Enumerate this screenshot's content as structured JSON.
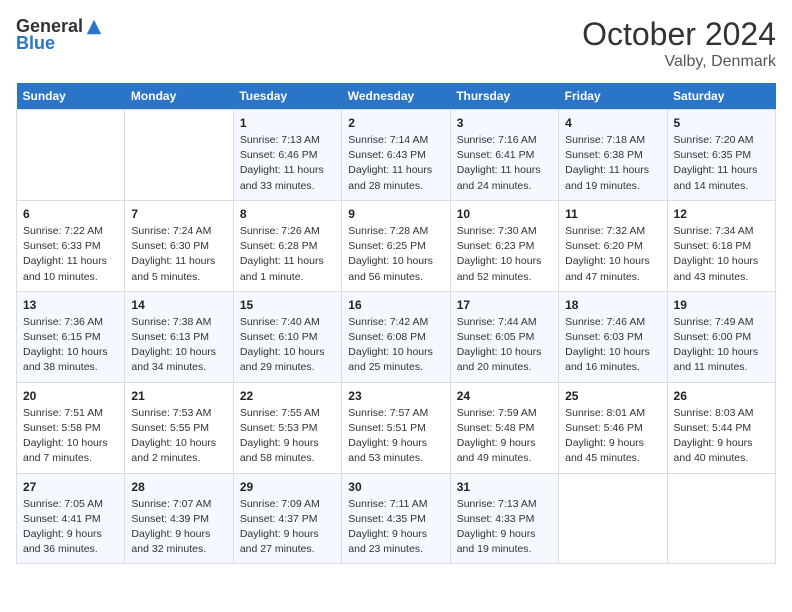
{
  "header": {
    "logo_general": "General",
    "logo_blue": "Blue",
    "month_title": "October 2024",
    "location": "Valby, Denmark"
  },
  "weekdays": [
    "Sunday",
    "Monday",
    "Tuesday",
    "Wednesday",
    "Thursday",
    "Friday",
    "Saturday"
  ],
  "weeks": [
    [
      {
        "day": "",
        "sunrise": "",
        "sunset": "",
        "daylight": ""
      },
      {
        "day": "",
        "sunrise": "",
        "sunset": "",
        "daylight": ""
      },
      {
        "day": "1",
        "sunrise": "Sunrise: 7:13 AM",
        "sunset": "Sunset: 6:46 PM",
        "daylight": "Daylight: 11 hours and 33 minutes."
      },
      {
        "day": "2",
        "sunrise": "Sunrise: 7:14 AM",
        "sunset": "Sunset: 6:43 PM",
        "daylight": "Daylight: 11 hours and 28 minutes."
      },
      {
        "day": "3",
        "sunrise": "Sunrise: 7:16 AM",
        "sunset": "Sunset: 6:41 PM",
        "daylight": "Daylight: 11 hours and 24 minutes."
      },
      {
        "day": "4",
        "sunrise": "Sunrise: 7:18 AM",
        "sunset": "Sunset: 6:38 PM",
        "daylight": "Daylight: 11 hours and 19 minutes."
      },
      {
        "day": "5",
        "sunrise": "Sunrise: 7:20 AM",
        "sunset": "Sunset: 6:35 PM",
        "daylight": "Daylight: 11 hours and 14 minutes."
      }
    ],
    [
      {
        "day": "6",
        "sunrise": "Sunrise: 7:22 AM",
        "sunset": "Sunset: 6:33 PM",
        "daylight": "Daylight: 11 hours and 10 minutes."
      },
      {
        "day": "7",
        "sunrise": "Sunrise: 7:24 AM",
        "sunset": "Sunset: 6:30 PM",
        "daylight": "Daylight: 11 hours and 5 minutes."
      },
      {
        "day": "8",
        "sunrise": "Sunrise: 7:26 AM",
        "sunset": "Sunset: 6:28 PM",
        "daylight": "Daylight: 11 hours and 1 minute."
      },
      {
        "day": "9",
        "sunrise": "Sunrise: 7:28 AM",
        "sunset": "Sunset: 6:25 PM",
        "daylight": "Daylight: 10 hours and 56 minutes."
      },
      {
        "day": "10",
        "sunrise": "Sunrise: 7:30 AM",
        "sunset": "Sunset: 6:23 PM",
        "daylight": "Daylight: 10 hours and 52 minutes."
      },
      {
        "day": "11",
        "sunrise": "Sunrise: 7:32 AM",
        "sunset": "Sunset: 6:20 PM",
        "daylight": "Daylight: 10 hours and 47 minutes."
      },
      {
        "day": "12",
        "sunrise": "Sunrise: 7:34 AM",
        "sunset": "Sunset: 6:18 PM",
        "daylight": "Daylight: 10 hours and 43 minutes."
      }
    ],
    [
      {
        "day": "13",
        "sunrise": "Sunrise: 7:36 AM",
        "sunset": "Sunset: 6:15 PM",
        "daylight": "Daylight: 10 hours and 38 minutes."
      },
      {
        "day": "14",
        "sunrise": "Sunrise: 7:38 AM",
        "sunset": "Sunset: 6:13 PM",
        "daylight": "Daylight: 10 hours and 34 minutes."
      },
      {
        "day": "15",
        "sunrise": "Sunrise: 7:40 AM",
        "sunset": "Sunset: 6:10 PM",
        "daylight": "Daylight: 10 hours and 29 minutes."
      },
      {
        "day": "16",
        "sunrise": "Sunrise: 7:42 AM",
        "sunset": "Sunset: 6:08 PM",
        "daylight": "Daylight: 10 hours and 25 minutes."
      },
      {
        "day": "17",
        "sunrise": "Sunrise: 7:44 AM",
        "sunset": "Sunset: 6:05 PM",
        "daylight": "Daylight: 10 hours and 20 minutes."
      },
      {
        "day": "18",
        "sunrise": "Sunrise: 7:46 AM",
        "sunset": "Sunset: 6:03 PM",
        "daylight": "Daylight: 10 hours and 16 minutes."
      },
      {
        "day": "19",
        "sunrise": "Sunrise: 7:49 AM",
        "sunset": "Sunset: 6:00 PM",
        "daylight": "Daylight: 10 hours and 11 minutes."
      }
    ],
    [
      {
        "day": "20",
        "sunrise": "Sunrise: 7:51 AM",
        "sunset": "Sunset: 5:58 PM",
        "daylight": "Daylight: 10 hours and 7 minutes."
      },
      {
        "day": "21",
        "sunrise": "Sunrise: 7:53 AM",
        "sunset": "Sunset: 5:55 PM",
        "daylight": "Daylight: 10 hours and 2 minutes."
      },
      {
        "day": "22",
        "sunrise": "Sunrise: 7:55 AM",
        "sunset": "Sunset: 5:53 PM",
        "daylight": "Daylight: 9 hours and 58 minutes."
      },
      {
        "day": "23",
        "sunrise": "Sunrise: 7:57 AM",
        "sunset": "Sunset: 5:51 PM",
        "daylight": "Daylight: 9 hours and 53 minutes."
      },
      {
        "day": "24",
        "sunrise": "Sunrise: 7:59 AM",
        "sunset": "Sunset: 5:48 PM",
        "daylight": "Daylight: 9 hours and 49 minutes."
      },
      {
        "day": "25",
        "sunrise": "Sunrise: 8:01 AM",
        "sunset": "Sunset: 5:46 PM",
        "daylight": "Daylight: 9 hours and 45 minutes."
      },
      {
        "day": "26",
        "sunrise": "Sunrise: 8:03 AM",
        "sunset": "Sunset: 5:44 PM",
        "daylight": "Daylight: 9 hours and 40 minutes."
      }
    ],
    [
      {
        "day": "27",
        "sunrise": "Sunrise: 7:05 AM",
        "sunset": "Sunset: 4:41 PM",
        "daylight": "Daylight: 9 hours and 36 minutes."
      },
      {
        "day": "28",
        "sunrise": "Sunrise: 7:07 AM",
        "sunset": "Sunset: 4:39 PM",
        "daylight": "Daylight: 9 hours and 32 minutes."
      },
      {
        "day": "29",
        "sunrise": "Sunrise: 7:09 AM",
        "sunset": "Sunset: 4:37 PM",
        "daylight": "Daylight: 9 hours and 27 minutes."
      },
      {
        "day": "30",
        "sunrise": "Sunrise: 7:11 AM",
        "sunset": "Sunset: 4:35 PM",
        "daylight": "Daylight: 9 hours and 23 minutes."
      },
      {
        "day": "31",
        "sunrise": "Sunrise: 7:13 AM",
        "sunset": "Sunset: 4:33 PM",
        "daylight": "Daylight: 9 hours and 19 minutes."
      },
      {
        "day": "",
        "sunrise": "",
        "sunset": "",
        "daylight": ""
      },
      {
        "day": "",
        "sunrise": "",
        "sunset": "",
        "daylight": ""
      }
    ]
  ]
}
